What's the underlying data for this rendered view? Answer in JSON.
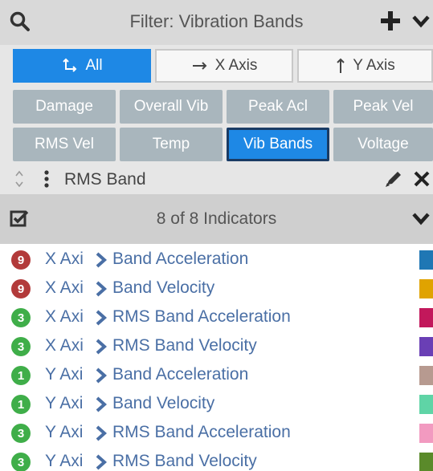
{
  "header": {
    "title": "Filter: Vibration Bands",
    "icons": [
      "search-icon",
      "plus-icon",
      "chevron-down-icon"
    ]
  },
  "axis_toggle": {
    "options": [
      {
        "label": "All",
        "icon": "axis-corner-icon",
        "active": true
      },
      {
        "label": "X Axis",
        "icon": "arrow-right-icon",
        "active": false
      },
      {
        "label": "Y Axis",
        "icon": "arrow-up-icon",
        "active": false
      }
    ],
    "active_color": "#1e88e5"
  },
  "categories": {
    "items": [
      "Damage",
      "Overall Vib",
      "Peak Acl",
      "Peak Vel",
      "RMS Vel",
      "Temp",
      "Vib Bands",
      "Voltage"
    ],
    "selected": "Vib Bands",
    "chip_color": "#a9b6bd"
  },
  "band": {
    "label": "RMS Band",
    "icons": [
      "sort-updown-icon",
      "vertical-dots-icon",
      "pencil-icon",
      "close-icon"
    ]
  },
  "indicators": {
    "count_label": "8 of 8 Indicators",
    "items": [
      {
        "badge": "9",
        "badge_color": "#b23a3a",
        "axis": "X Axi",
        "name": "Band Acceleration",
        "swatch": "#1f77b4"
      },
      {
        "badge": "9",
        "badge_color": "#b23a3a",
        "axis": "X Axi",
        "name": "Band Velocity",
        "swatch": "#e0a300"
      },
      {
        "badge": "3",
        "badge_color": "#3fae49",
        "axis": "X Axi",
        "name": "RMS Band Acceleration",
        "swatch": "#c2185b"
      },
      {
        "badge": "3",
        "badge_color": "#3fae49",
        "axis": "X Axi",
        "name": "RMS Band Velocity",
        "swatch": "#6a3fb5"
      },
      {
        "badge": "1",
        "badge_color": "#3fae49",
        "axis": "Y Axi",
        "name": "Band Acceleration",
        "swatch": "#b79a90"
      },
      {
        "badge": "1",
        "badge_color": "#3fae49",
        "axis": "Y Axi",
        "name": "Band Velocity",
        "swatch": "#5fd4a6"
      },
      {
        "badge": "3",
        "badge_color": "#3fae49",
        "axis": "Y Axi",
        "name": "RMS Band Acceleration",
        "swatch": "#f29ac0"
      },
      {
        "badge": "3",
        "badge_color": "#3fae49",
        "axis": "Y Axi",
        "name": "RMS Band Velocity",
        "swatch": "#5a8a2a"
      }
    ]
  }
}
